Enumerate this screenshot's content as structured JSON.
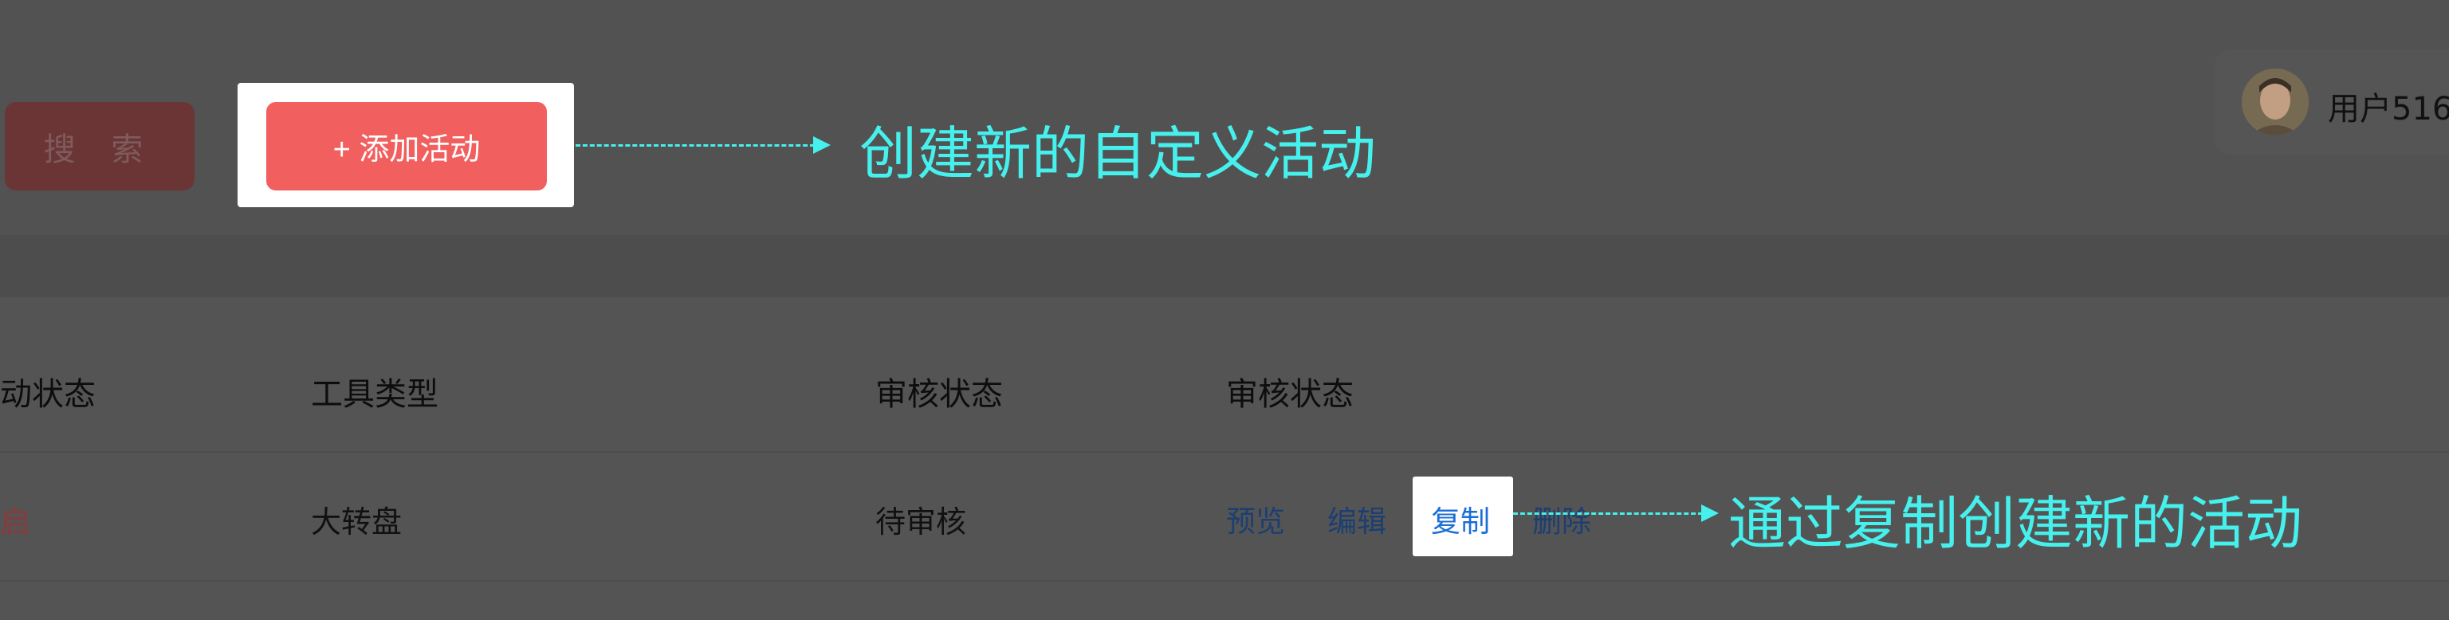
{
  "toolbar": {
    "search_label": "搜 索",
    "add_activity_label": "+ 添加活动"
  },
  "user": {
    "name": "用户516"
  },
  "table": {
    "headers": [
      "动状态",
      "工具类型",
      "审核状态",
      "审核状态"
    ],
    "rows": [
      {
        "status": "启",
        "tool_type": "大转盘",
        "review_status": "待审核",
        "actions": {
          "preview": "预览",
          "edit": "编辑",
          "copy": "复制",
          "delete": "删除"
        }
      }
    ]
  },
  "annotations": {
    "create_new": "创建新的自定义活动",
    "copy_to_create": "通过复制创建新的活动"
  },
  "colors": {
    "annotation": "#46f0ec",
    "primary_button": "#f15f5f",
    "link": "#1c3e71",
    "highlight_link": "#1b6ed6",
    "status_text": "#8b3a3a"
  },
  "icons": {
    "avatar": "avatar-icon",
    "arrow": "arrow-right-icon"
  }
}
